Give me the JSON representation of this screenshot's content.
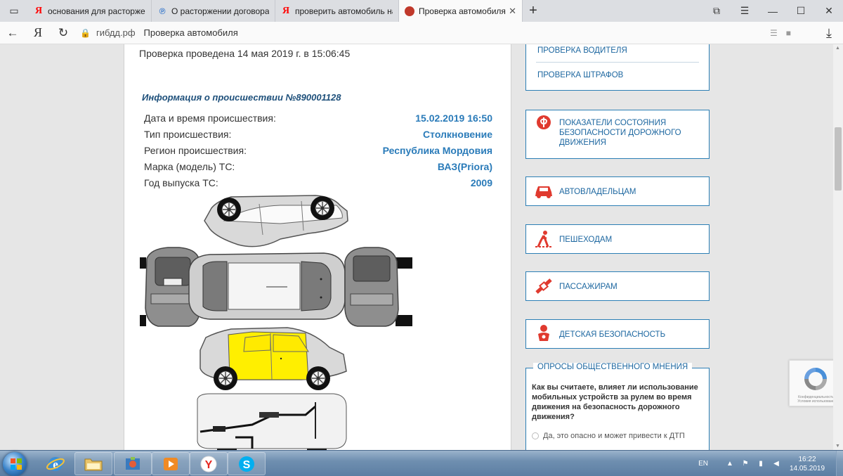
{
  "browser": {
    "tabs": [
      {
        "title": "основания для расторжен",
        "favicon": "yandex-icon",
        "active": false
      },
      {
        "title": "О расторжении договора",
        "favicon": "p-icon",
        "active": false
      },
      {
        "title": "проверить автомобиль на",
        "favicon": "yandex-icon",
        "active": false
      },
      {
        "title": "Проверка автомобиля",
        "favicon": "gibdd-icon",
        "active": true
      }
    ],
    "address": {
      "domain": "гибдд.рф",
      "page_title": "Проверка автомобиля"
    }
  },
  "main": {
    "check_date": "Проверка проведена 14 мая 2019 г. в 15:06:45",
    "incident_title": "Информация о происшествии №890001128",
    "info": [
      {
        "label": "Дата и время происшествия:",
        "value": "15.02.2019 16:50"
      },
      {
        "label": "Тип происшествия:",
        "value": "Столкновение"
      },
      {
        "label": "Регион происшествия:",
        "value": "Республика Мордовия"
      },
      {
        "label": "Марка (модель) ТС:",
        "value": "ВАЗ(Priora)"
      },
      {
        "label": "Год выпуска ТС:",
        "value": "2009"
      }
    ],
    "damage_zone": "right-side-doors",
    "damage_color": "#ffef00"
  },
  "sidebar": {
    "links": [
      "ПРОВЕРКА ВОДИТЕЛЯ",
      "ПРОВЕРКА ШТРАФОВ"
    ],
    "items": [
      {
        "label": "ПОКАЗАТЕЛИ СОСТОЯНИЯ БЕЗОПАСНОСТИ ДОРОЖНОГО ДВИЖЕНИЯ",
        "icon": "stats-icon"
      },
      {
        "label": "АВТОВЛАДЕЛЬЦАМ",
        "icon": "car-icon"
      },
      {
        "label": "ПЕШЕХОДАМ",
        "icon": "pedestrian-icon"
      },
      {
        "label": "ПАССАЖИРАМ",
        "icon": "seatbelt-icon"
      },
      {
        "label": "ДЕТСКАЯ БЕЗОПАСНОСТЬ",
        "icon": "child-icon"
      }
    ],
    "poll": {
      "title": "ОПРОСЫ ОБЩЕСТВЕННОГО МНЕНИЯ",
      "question": "Как вы считаете, влияет ли использование мобильных устройств за рулем во время движения на безопасность дорожного движения?",
      "option1": "Да, это опасно и может привести к ДТП"
    },
    "accent": "#2c7fb5",
    "icon_color": "#e03a2f"
  },
  "captcha": {
    "text": "Конфиденциальность - Условия использования"
  },
  "taskbar": {
    "lang": "EN",
    "time": "16:22",
    "date": "14.05.2019"
  }
}
